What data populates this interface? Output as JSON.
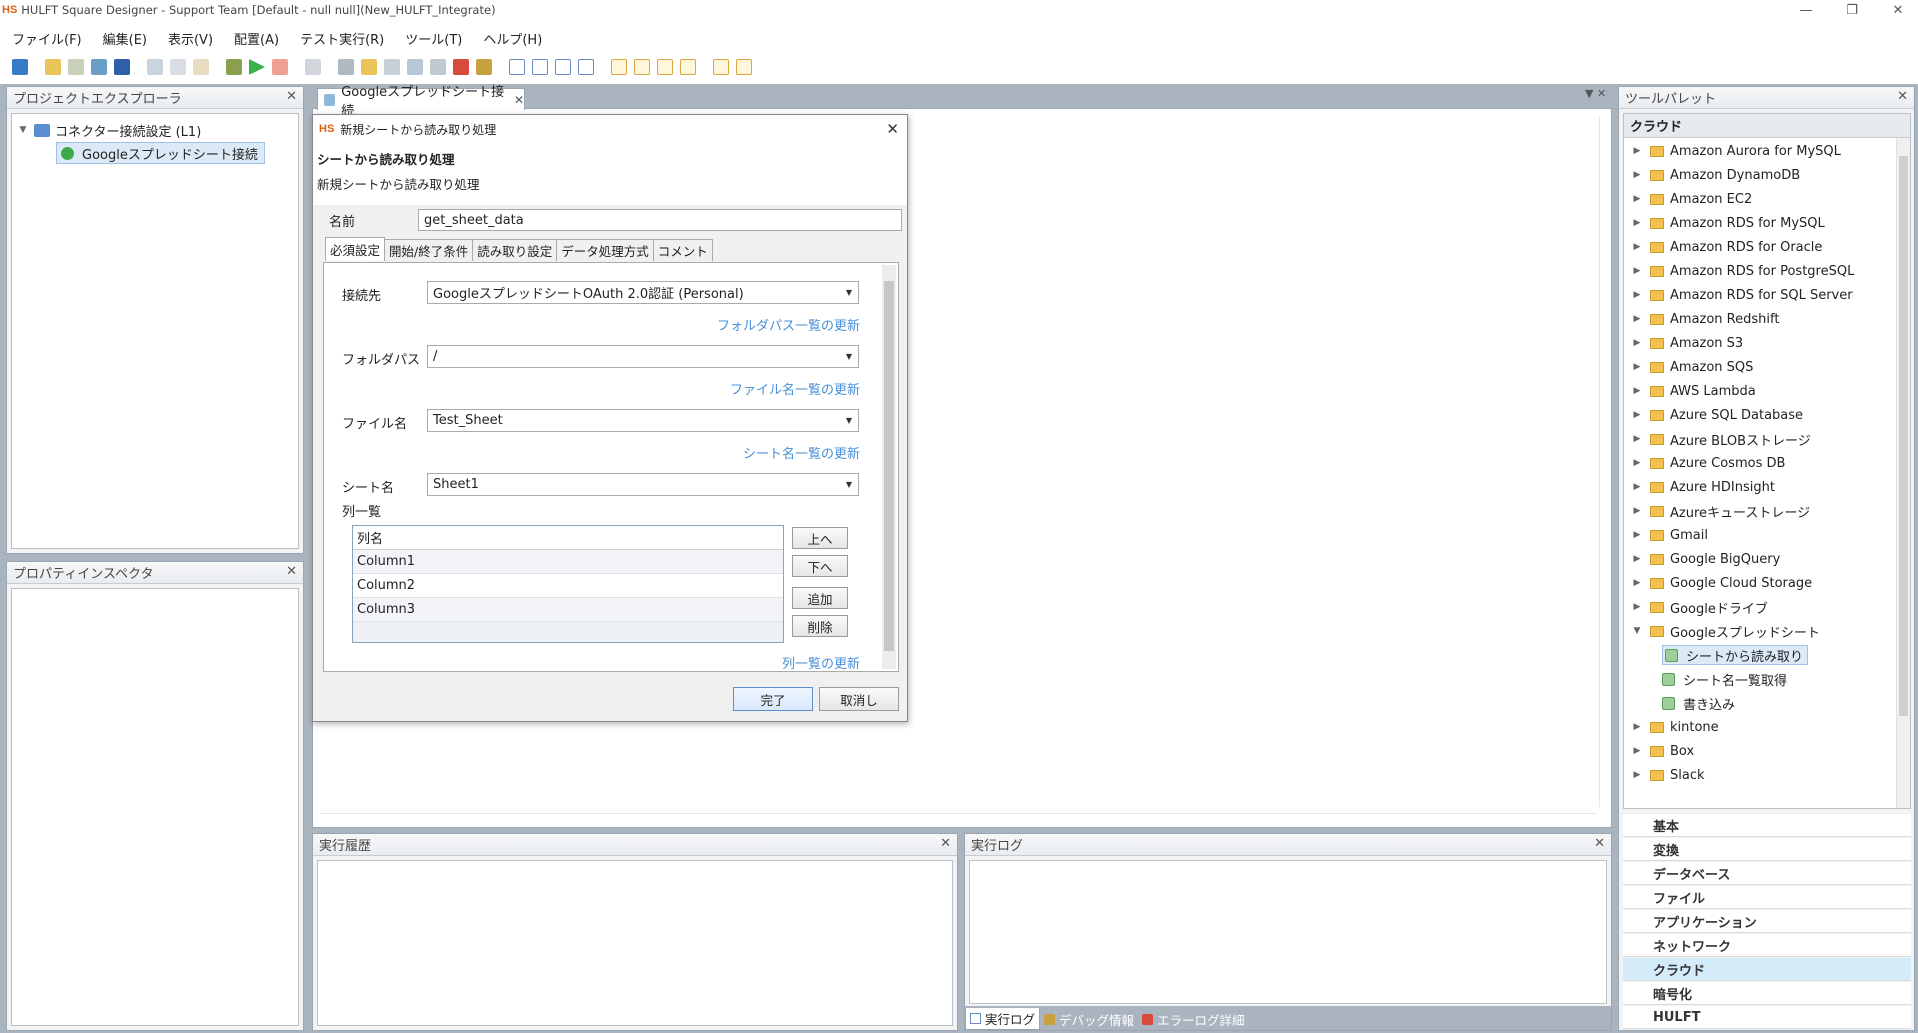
{
  "app": {
    "logo": "HS",
    "title": "HULFT Square Designer - Support Team [Default - null null](New_HULFT_Integrate)"
  },
  "menu": [
    "ファイル(F)",
    "編集(E)",
    "表示(V)",
    "配置(A)",
    "テスト実行(R)",
    "ツール(T)",
    "ヘルプ(H)"
  ],
  "project_explorer": {
    "title": "プロジェクトエクスプローラ",
    "root": "コネクター接続設定 (L1)",
    "child": "Googleスプレッドシート接続"
  },
  "property_inspector": {
    "title": "プロパティインスペクタ"
  },
  "editor": {
    "tab_label": "Googleスプレッドシート接続"
  },
  "dialog": {
    "logo": "HS",
    "window_title": "新規シートから読み取り処理",
    "heading": "シートから読み取り処理",
    "subheading": "新規シートから読み取り処理",
    "name_label": "名前",
    "name_value": "get_sheet_data",
    "tabs": [
      "必須設定",
      "開始/終了条件",
      "読み取り設定",
      "データ処理方式",
      "コメント"
    ],
    "connection_label": "接続先",
    "connection_value": "GoogleスプレッドシートOAuth 2.0認証 (Personal)",
    "refresh_folder": "フォルダパス一覧の更新",
    "folder_label": "フォルダパス",
    "folder_value": "/",
    "refresh_file": "ファイル名一覧の更新",
    "file_label": "ファイル名",
    "file_value": "Test_Sheet",
    "refresh_sheet": "シート名一覧の更新",
    "sheet_label": "シート名",
    "sheet_value": "Sheet1",
    "columns_label": "列一覧",
    "columns_header": "列名",
    "columns": [
      "Column1",
      "Column2",
      "Column3"
    ],
    "btn_up": "上へ",
    "btn_down": "下へ",
    "btn_add": "追加",
    "btn_delete": "削除",
    "refresh_columns": "列一覧の更新",
    "btn_finish": "完了",
    "btn_cancel": "取消し"
  },
  "exec_history": {
    "title": "実行履歴"
  },
  "exec_log": {
    "title": "実行ログ",
    "tabs": [
      "実行ログ",
      "デバッグ情報",
      "エラーログ詳細"
    ]
  },
  "palette": {
    "title": "ツールパレット",
    "section": "クラウド",
    "items": [
      "Amazon Aurora for MySQL",
      "Amazon DynamoDB",
      "Amazon EC2",
      "Amazon RDS for MySQL",
      "Amazon RDS for Oracle",
      "Amazon RDS for PostgreSQL",
      "Amazon RDS for SQL Server",
      "Amazon Redshift",
      "Amazon S3",
      "Amazon SQS",
      "AWS Lambda",
      "Azure SQL Database",
      "Azure BLOBストレージ",
      "Azure Cosmos DB",
      "Azure HDInsight",
      "Azureキューストレージ",
      "Gmail",
      "Google BigQuery",
      "Google Cloud Storage",
      "Googleドライブ",
      "Googleスプレッドシート"
    ],
    "sub_items": [
      "シートから読み取り",
      "シート名一覧取得",
      "書き込み"
    ],
    "after_items": [
      "kintone",
      "Box",
      "Slack"
    ],
    "categories": [
      "基本",
      "変換",
      "データベース",
      "ファイル",
      "アプリケーション",
      "ネットワーク",
      "クラウド",
      "暗号化",
      "HULFT"
    ],
    "active_category": "クラウド"
  }
}
